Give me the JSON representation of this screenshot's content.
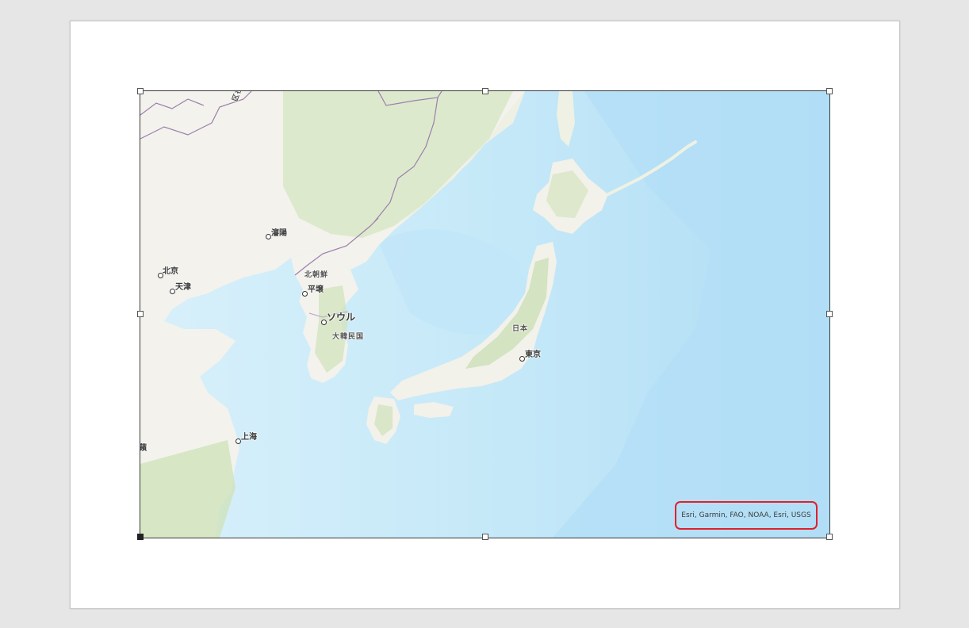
{
  "map": {
    "labels": {
      "beijing": "北京",
      "tianjin": "天津",
      "shenyang": "瀋陽",
      "pyongyang": "平壌",
      "north_korea": "北朝鮮",
      "seoul": "ソウル",
      "south_korea": "大韓民国",
      "shanghai": "上海",
      "japan": "日本",
      "tokyo": "東京",
      "russia_fragment": "区在",
      "edge_fragment": "蘋"
    },
    "attribution": "Esri, Garmin, FAO, NOAA, Esri, USGS",
    "colors": {
      "ocean_deep": "#b9e2f7",
      "ocean_shallow": "#dcf2fb",
      "land": "#f4f3ee",
      "vegetation": "#d9e6c6",
      "border": "#9a7fae",
      "selection_border": "#e0202a"
    }
  }
}
